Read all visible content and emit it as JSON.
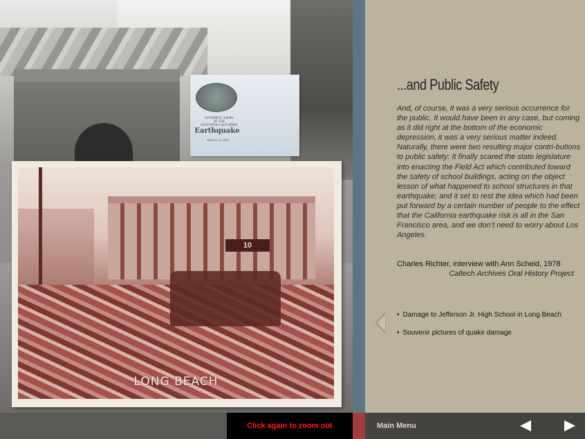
{
  "envelope": {
    "line1": "AUTHENTIC VIEWS",
    "line2": "OF THE",
    "line3": "SOUTHERN CALIFORNIA",
    "title": "Earthquake",
    "date": "MARCH 10, 1933"
  },
  "photo": {
    "sign_text": "10",
    "caption": "LONG BEACH"
  },
  "article": {
    "heading": "...and Public Safety",
    "quote": "And, of course, it was a very serious occurrence for the public. It would have been in any case, but coming as it did right at the bottom of the economic depression, it was a very serious matter indeed. Naturally, there were two resulting major contri-butions to public safety: It finally scared the state legislature into enacting the Field Act which contributed toward the safety of school buildings, acting on the object lesson of what happened to school structures in that earthquake; and it set to rest the idea which had been put forward by a certain number of people to the effect that the California earthquake risk is all in the San Francisco area, and we don’t need to worry about Los Angeles.",
    "attribution": "Charles Richter, interview with Ann Scheid, 1978",
    "source": "Caltech Archives Oral History Project"
  },
  "links": [
    {
      "label": "Damage to Jefferson Jr. High School in Long Beach"
    },
    {
      "label": "Souvenir pictures of quake damage"
    }
  ],
  "bullet_glyph": "•",
  "bottom_bar": {
    "zoom_label": "Click again to zoom out",
    "main_menu": "Main Menu",
    "prev_icon": "left-arrow-icon",
    "next_icon": "right-arrow-icon"
  },
  "colors": {
    "panel_bg": "#bcb39e",
    "divider": "#5d7585",
    "zoom_text": "#ff1a1a",
    "accent_block": "#a33b41"
  }
}
